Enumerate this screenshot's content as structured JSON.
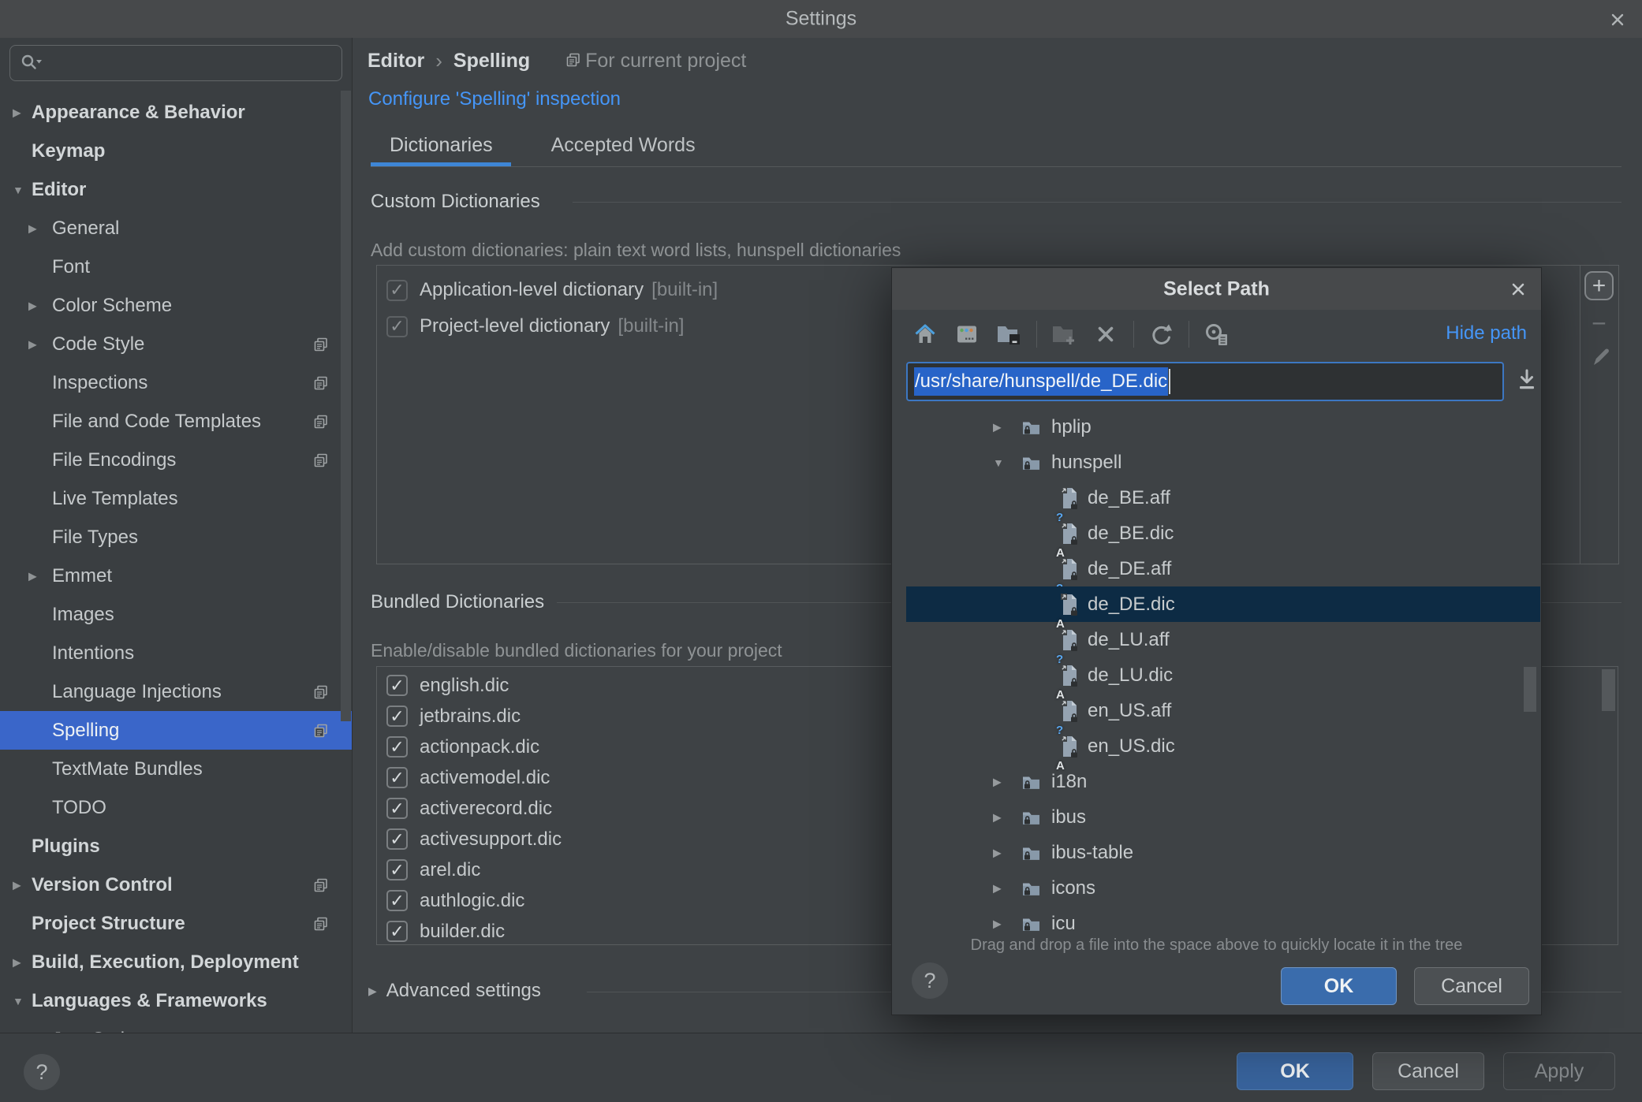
{
  "window": {
    "title": "Settings"
  },
  "sidebar": {
    "search": {
      "placeholder": ""
    },
    "items": [
      {
        "label": "Appearance & Behavior",
        "level": 0,
        "arrow": "collapsed",
        "bold": true
      },
      {
        "label": "Keymap",
        "level": 0,
        "bold": true
      },
      {
        "label": "Editor",
        "level": 0,
        "arrow": "expanded",
        "bold": true
      },
      {
        "label": "General",
        "level": 1,
        "arrow": "collapsed"
      },
      {
        "label": "Font",
        "level": 1
      },
      {
        "label": "Color Scheme",
        "level": 1,
        "arrow": "collapsed"
      },
      {
        "label": "Code Style",
        "level": 1,
        "arrow": "collapsed",
        "per_project": true
      },
      {
        "label": "Inspections",
        "level": 1,
        "per_project": true
      },
      {
        "label": "File and Code Templates",
        "level": 1,
        "per_project": true
      },
      {
        "label": "File Encodings",
        "level": 1,
        "per_project": true
      },
      {
        "label": "Live Templates",
        "level": 1
      },
      {
        "label": "File Types",
        "level": 1
      },
      {
        "label": "Emmet",
        "level": 1,
        "arrow": "collapsed"
      },
      {
        "label": "Images",
        "level": 1
      },
      {
        "label": "Intentions",
        "level": 1
      },
      {
        "label": "Language Injections",
        "level": 1,
        "per_project": true
      },
      {
        "label": "Spelling",
        "level": 1,
        "per_project": true,
        "selected": true
      },
      {
        "label": "TextMate Bundles",
        "level": 1
      },
      {
        "label": "TODO",
        "level": 1
      },
      {
        "label": "Plugins",
        "level": 0,
        "bold": true
      },
      {
        "label": "Version Control",
        "level": 0,
        "arrow": "collapsed",
        "bold": true,
        "per_project": true
      },
      {
        "label": "Project Structure",
        "level": 0,
        "bold": true,
        "per_project": true
      },
      {
        "label": "Build, Execution, Deployment",
        "level": 0,
        "arrow": "collapsed",
        "bold": true
      },
      {
        "label": "Languages & Frameworks",
        "level": 0,
        "arrow": "expanded",
        "bold": true
      },
      {
        "label": "JavaScript",
        "level": 1,
        "arrow": "collapsed",
        "per_project": true,
        "clipped": true
      }
    ]
  },
  "header": {
    "breadcrumb": [
      "Editor",
      "Spelling"
    ],
    "separator": "›",
    "scope_label": "For current project",
    "configure_link": "Configure 'Spelling' inspection"
  },
  "tabs": [
    {
      "label": "Dictionaries",
      "active": true
    },
    {
      "label": "Accepted Words",
      "active": false
    }
  ],
  "custom_dictionaries": {
    "title": "Custom Dictionaries",
    "description": "Add custom dictionaries: plain text word lists, hunspell dictionaries",
    "items": [
      {
        "label": "Application-level dictionary",
        "suffix": "[built-in]",
        "checked": true,
        "disabled": true
      },
      {
        "label": "Project-level dictionary",
        "suffix": "[built-in]",
        "checked": true,
        "disabled": true
      }
    ],
    "toolbar": {
      "add": "+",
      "remove": "−",
      "edit": "edit"
    }
  },
  "bundled_dictionaries": {
    "title": "Bundled Dictionaries",
    "description": "Enable/disable bundled dictionaries for your project",
    "items": [
      {
        "label": "english.dic",
        "checked": true
      },
      {
        "label": "jetbrains.dic",
        "checked": true
      },
      {
        "label": "actionpack.dic",
        "checked": true
      },
      {
        "label": "activemodel.dic",
        "checked": true
      },
      {
        "label": "activerecord.dic",
        "checked": true
      },
      {
        "label": "activesupport.dic",
        "checked": true
      },
      {
        "label": "arel.dic",
        "checked": true
      },
      {
        "label": "authlogic.dic",
        "checked": true
      },
      {
        "label": "builder.dic",
        "checked": true
      }
    ]
  },
  "advanced_settings": {
    "label": "Advanced settings"
  },
  "footer": {
    "help": "?",
    "ok": "OK",
    "cancel": "Cancel",
    "apply": "Apply"
  },
  "dialog": {
    "title": "Select Path",
    "toolbar": {
      "icons": [
        "home",
        "desktop",
        "project-folder",
        "new-folder",
        "delete",
        "refresh",
        "show-hidden"
      ],
      "hide_path": "Hide path"
    },
    "path_input": {
      "value": "/usr/share/hunspell/de_DE.dic",
      "selected": true
    },
    "tree": [
      {
        "name": "hplip",
        "type": "folder",
        "depth": 1,
        "state": "collapsed"
      },
      {
        "name": "hunspell",
        "type": "folder",
        "depth": 1,
        "state": "expanded"
      },
      {
        "name": "de_BE.aff",
        "type": "file",
        "kind": "aff",
        "depth": 2
      },
      {
        "name": "de_BE.dic",
        "type": "file",
        "kind": "dic",
        "depth": 2
      },
      {
        "name": "de_DE.aff",
        "type": "file",
        "kind": "aff",
        "depth": 2
      },
      {
        "name": "de_DE.dic",
        "type": "file",
        "kind": "dic",
        "depth": 2,
        "selected": true
      },
      {
        "name": "de_LU.aff",
        "type": "file",
        "kind": "aff",
        "depth": 2
      },
      {
        "name": "de_LU.dic",
        "type": "file",
        "kind": "dic",
        "depth": 2
      },
      {
        "name": "en_US.aff",
        "type": "file",
        "kind": "aff",
        "depth": 2
      },
      {
        "name": "en_US.dic",
        "type": "file",
        "kind": "dic",
        "depth": 2
      },
      {
        "name": "i18n",
        "type": "folder",
        "depth": 1,
        "state": "collapsed"
      },
      {
        "name": "ibus",
        "type": "folder",
        "depth": 1,
        "state": "collapsed"
      },
      {
        "name": "ibus-table",
        "type": "folder",
        "depth": 1,
        "state": "collapsed"
      },
      {
        "name": "icons",
        "type": "folder",
        "depth": 1,
        "state": "collapsed"
      },
      {
        "name": "icu",
        "type": "folder",
        "depth": 1,
        "state": "collapsed",
        "clipped": true
      }
    ],
    "hint": "Drag and drop a file into the space above to quickly locate it in the tree",
    "help": "?",
    "ok": "OK",
    "cancel": "Cancel"
  },
  "colors": {
    "link": "#4596f8",
    "tab_underline": "#3e86d6",
    "sidebar_selection": "#3a66c9",
    "tree_selection": "#0d2b44",
    "text_selection_bg": "#2864c8",
    "dialog_ok_bg": "#3a6cac",
    "footer_ok_bg": "#38639c"
  }
}
